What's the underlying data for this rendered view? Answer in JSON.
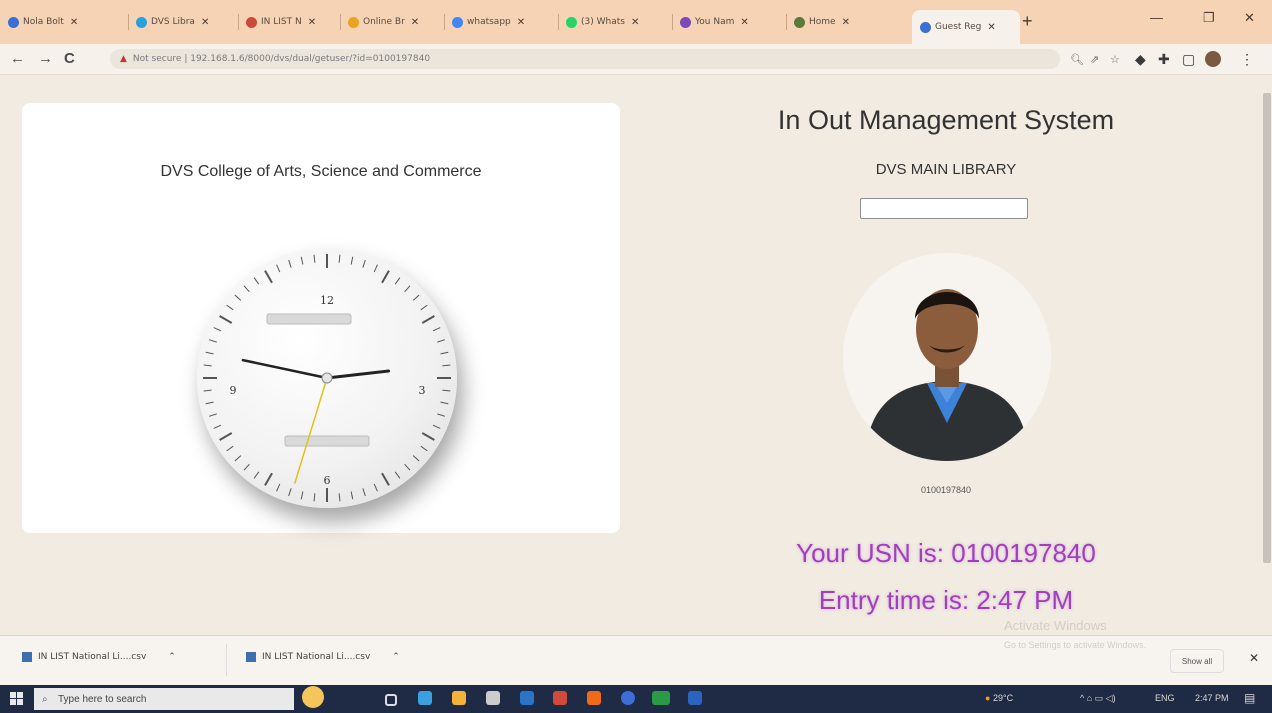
{
  "browser": {
    "tabs": [
      {
        "label": "Nola Bolt",
        "color": "#3b6fd6"
      },
      {
        "label": "DVS Libra",
        "color": "#2aa0d8"
      },
      {
        "label": "IN LIST N",
        "color": "#c84b3b"
      },
      {
        "label": "Online Br",
        "color": "#e8a320"
      },
      {
        "label": "whatsapp",
        "color": "#4285f4"
      },
      {
        "label": "(3) Whats",
        "color": "#25d366"
      },
      {
        "label": "You Nam",
        "color": "#7a4ab8"
      },
      {
        "label": "Home",
        "color": "#5c7a3a"
      },
      {
        "label": "Guest Reg",
        "color": "#3b6fd6",
        "active": true
      }
    ],
    "window_controls": {
      "minimize": "—",
      "maximize": "❐",
      "close": "✕"
    },
    "url": "Not secure | 192.168.1.6/8000/dvs/dual/getuser/?id=0100197840",
    "nav": {
      "back": "←",
      "forward": "→",
      "reload": "C"
    }
  },
  "clock_card": {
    "college_name": "DVS College of Arts, Science and Commerce",
    "numbers": {
      "n12": "12",
      "n3": "3",
      "n6": "6",
      "n9": "9"
    },
    "time_shown": "2:47",
    "hour_angle": 83.5,
    "minute_angle": 282,
    "second_angle": 197
  },
  "system": {
    "title": "In Out Management System",
    "library_name": "DVS MAIN LIBRARY",
    "usn_input_value": "",
    "photo_caption": "0100197840",
    "usn_label": "Your USN is: 0100197840",
    "entry_label": "Entry time is: 2:47 PM"
  },
  "watermark": {
    "line1": "Activate Windows",
    "line2": "Go to Settings to activate Windows."
  },
  "downloads": {
    "items": [
      "IN LIST National Li....csv",
      "IN LIST National Li....csv"
    ],
    "show_all": "Show all"
  },
  "taskbar": {
    "search_placeholder": "Type here to search",
    "weather": "29°C",
    "lang": "ENG",
    "time": "2:47 PM"
  }
}
